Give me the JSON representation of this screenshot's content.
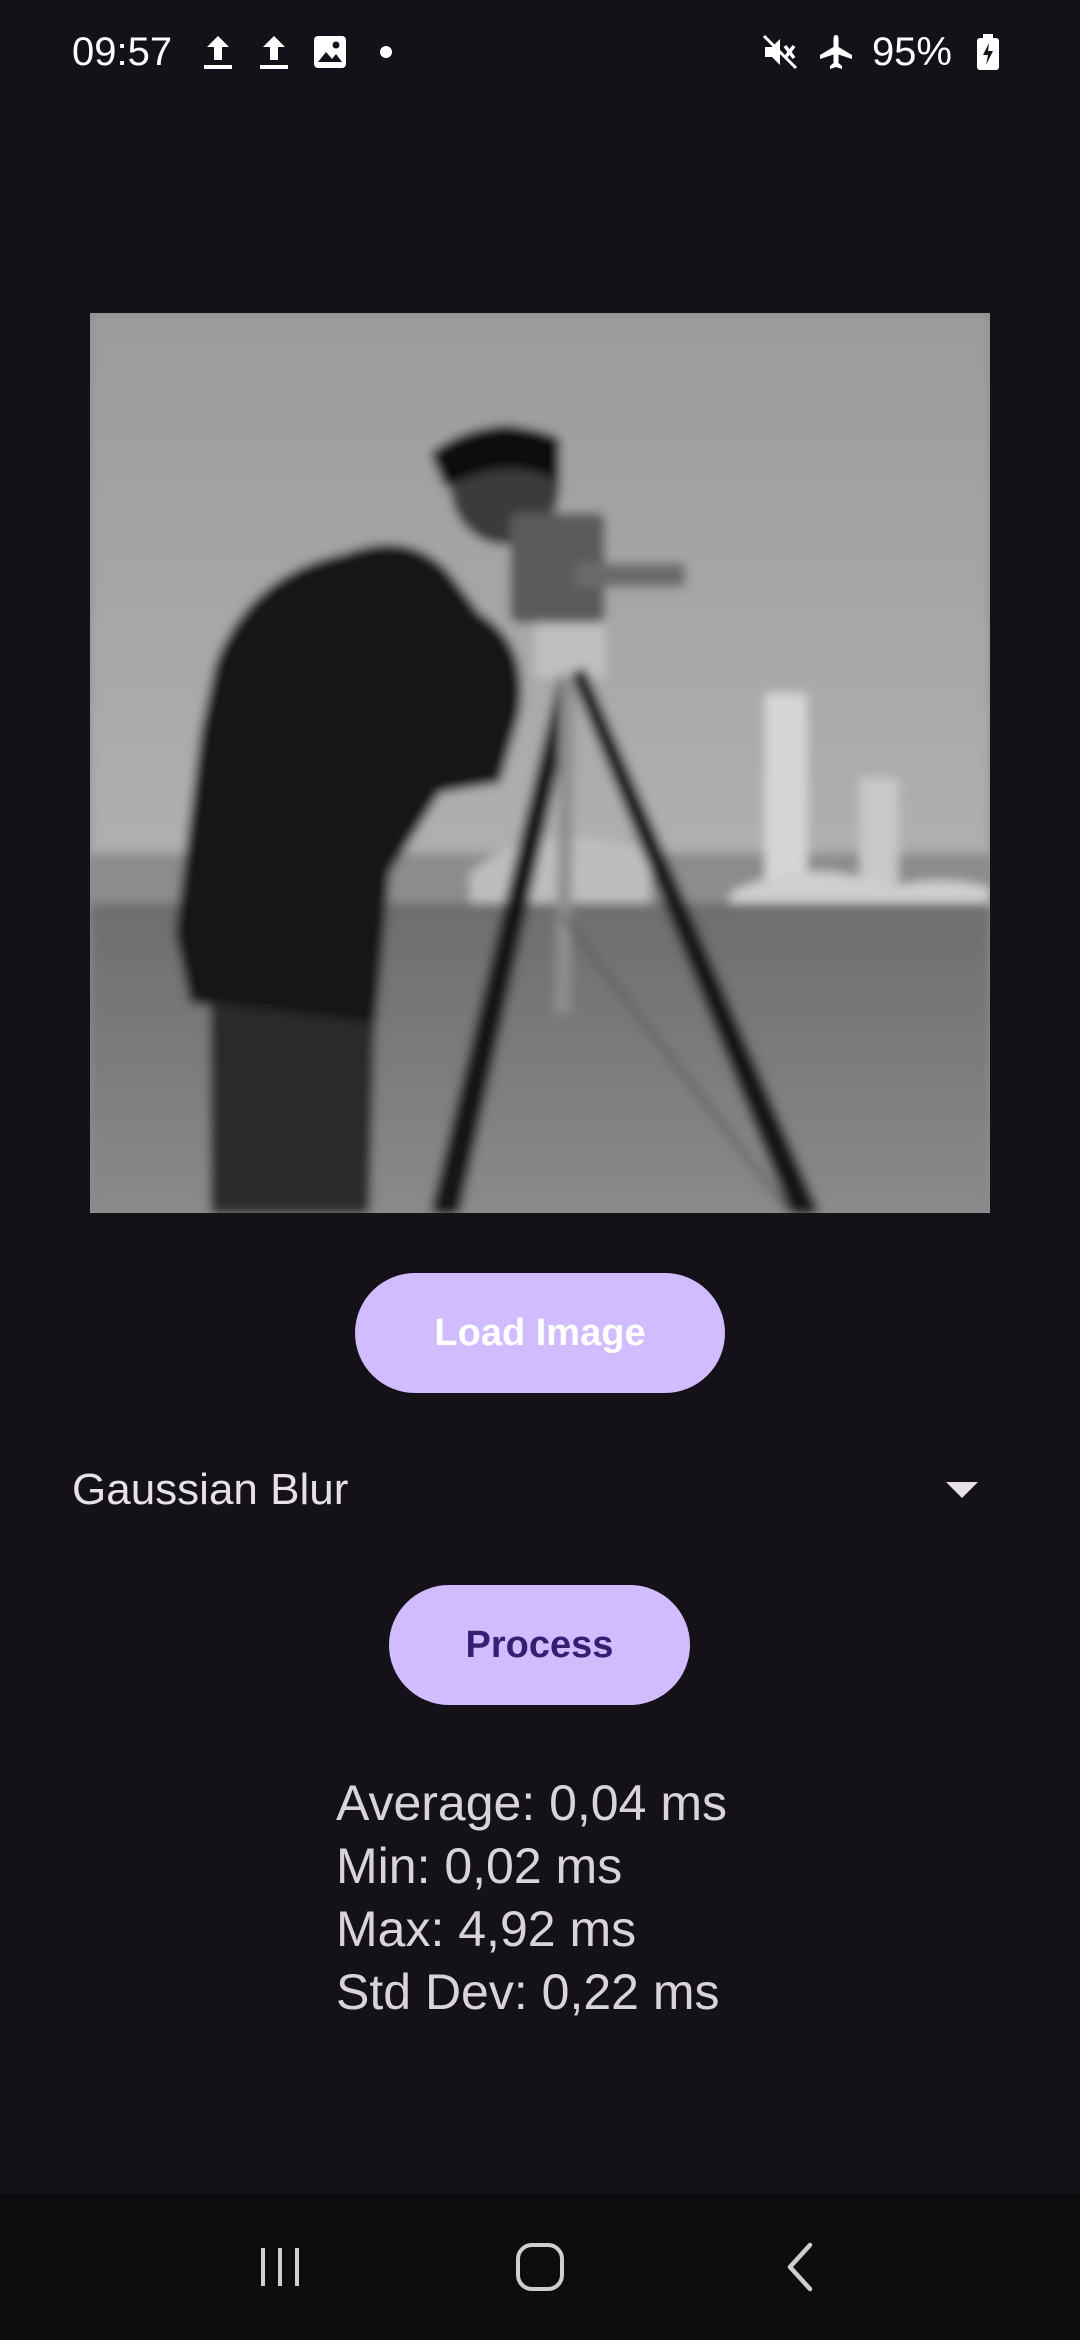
{
  "status_bar": {
    "time": "09:57",
    "battery": "95%",
    "left_icons": [
      "upload-icon",
      "upload-icon",
      "image-icon",
      "dot-icon"
    ],
    "right_icons": [
      "mute-icon",
      "airplane-mode-icon",
      "battery-charging-icon"
    ]
  },
  "buttons": {
    "load_image": "Load Image",
    "process": "Process"
  },
  "filter": {
    "selected": "Gaussian Blur"
  },
  "stats": {
    "average": "Average: 0,04 ms",
    "min": "Min: 0,02 ms",
    "max": "Max: 4,92 ms",
    "std_dev": "Std Dev: 0,22 ms"
  },
  "colors": {
    "background": "#141218",
    "accent": "#D0BCFF",
    "on_accent": "#381E72"
  },
  "nav": {
    "icons": [
      "recents-icon",
      "home-icon",
      "back-icon"
    ]
  }
}
